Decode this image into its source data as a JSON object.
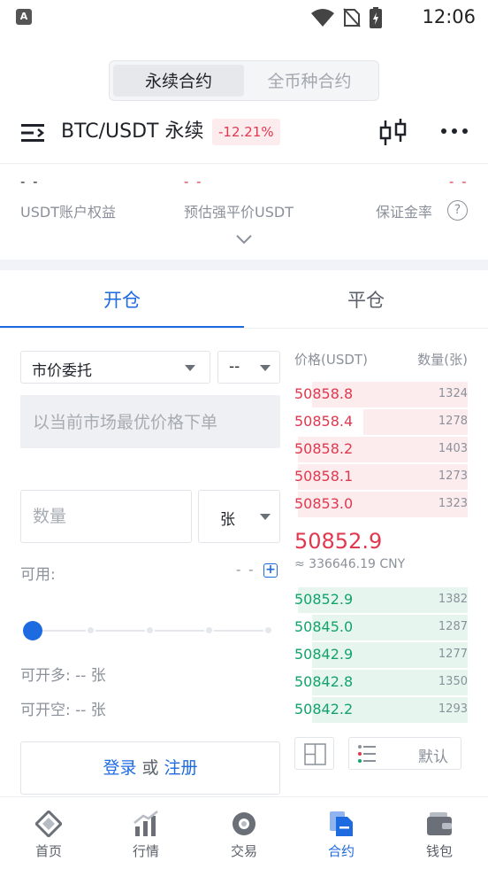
{
  "status_bar": {
    "time": "12:06",
    "app_badge": "A"
  },
  "contract_type": {
    "options": [
      "永续合约",
      "全币种合约"
    ],
    "active": 0
  },
  "pair": {
    "name": "BTC/USDT 永续",
    "change": "-12.21%"
  },
  "stats": {
    "equity": {
      "value": "- -",
      "label": "USDT账户权益"
    },
    "liq_price": {
      "value": "- -",
      "label": "预估强平价USDT"
    },
    "margin_rate": {
      "value": "- -",
      "label": "保证金率"
    }
  },
  "trade_tabs": [
    "开仓",
    "平仓"
  ],
  "order_form": {
    "order_type": "市价委托",
    "leverage": "--",
    "market_hint": "以当前市场最优价格下单",
    "qty_placeholder": "数量",
    "unit": "张",
    "available_label": "可用:",
    "available_value": "- -",
    "slider_level_pct": 0,
    "can_long": "可开多: -- 张",
    "can_short": "可开空: -- 张",
    "login": "登录",
    "or": "或",
    "register": "注册"
  },
  "orderbook": {
    "price_header": "价格(USDT)",
    "qty_header": "数量(张)",
    "asks": [
      {
        "price": "50858.8",
        "qty": "1324",
        "depth": 0.9
      },
      {
        "price": "50858.4",
        "qty": "1278",
        "depth": 0.6
      },
      {
        "price": "50858.2",
        "qty": "1403",
        "depth": 0.98
      },
      {
        "price": "50858.1",
        "qty": "1273",
        "depth": 0.98
      },
      {
        "price": "50853.0",
        "qty": "1323",
        "depth": 0.98
      }
    ],
    "last_price": "50852.9",
    "last_price_cny": "≈ 336646.19 CNY",
    "bids": [
      {
        "price": "50852.9",
        "qty": "1382",
        "depth": 0.98
      },
      {
        "price": "50845.0",
        "qty": "1287",
        "depth": 0.9
      },
      {
        "price": "50842.9",
        "qty": "1277",
        "depth": 0.9
      },
      {
        "price": "50842.8",
        "qty": "1350",
        "depth": 0.9
      },
      {
        "price": "50842.2",
        "qty": "1293",
        "depth": 0.9
      }
    ],
    "default_label": "默认"
  },
  "colors": {
    "accent": "#1e6ae1",
    "down": "#e0384f",
    "up": "#13a36a"
  },
  "nav": [
    {
      "label": "首页",
      "icon": "home-icon"
    },
    {
      "label": "行情",
      "icon": "market-icon"
    },
    {
      "label": "交易",
      "icon": "trade-icon"
    },
    {
      "label": "合约",
      "icon": "contract-icon",
      "active": true
    },
    {
      "label": "钱包",
      "icon": "wallet-icon"
    }
  ]
}
